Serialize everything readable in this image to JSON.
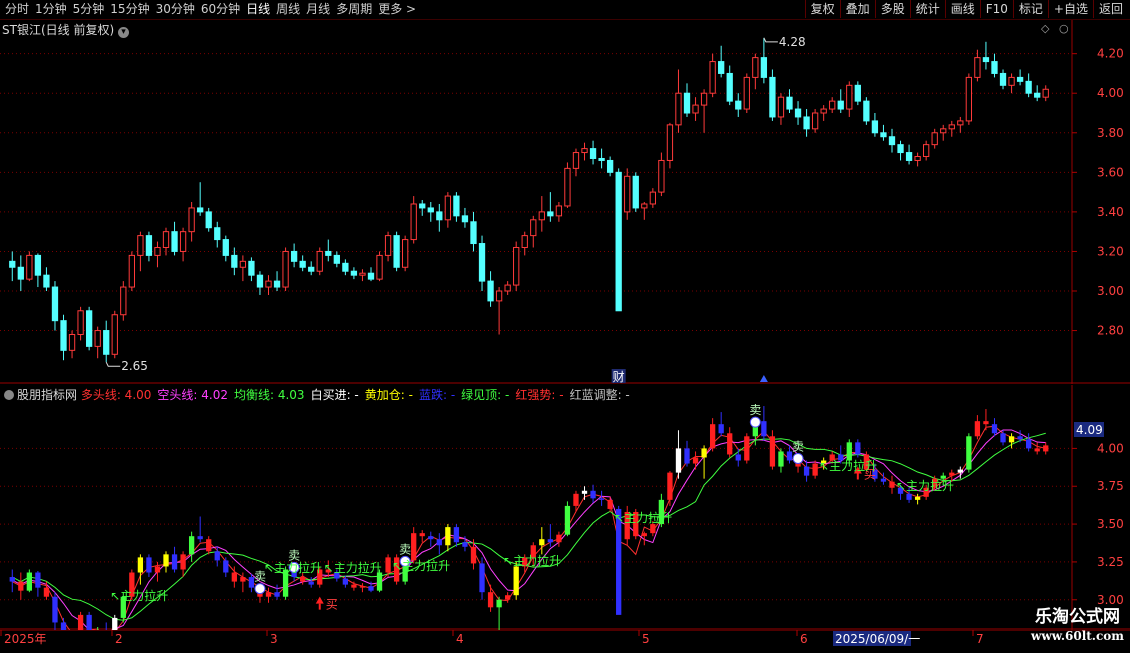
{
  "toolbar": {
    "periods": [
      "分时",
      "1分钟",
      "5分钟",
      "15分钟",
      "30分钟",
      "60分钟",
      "日线",
      "周线",
      "月线",
      "多周期",
      "更多 >"
    ],
    "active_period": "日线",
    "buttons": [
      "复权",
      "叠加",
      "多股",
      "统计",
      "画线",
      "F10",
      "标记",
      "+自选",
      "返回"
    ]
  },
  "main_chart": {
    "title": "ST银江(日线 前复权)",
    "price_axis": [
      "4.20",
      "4.00",
      "3.80",
      "3.60",
      "3.40",
      "3.20",
      "3.00",
      "2.80"
    ],
    "high_label": "4.28",
    "low_label": "2.65",
    "marker_cai": "财"
  },
  "indicator": {
    "name": "股朋指标网",
    "items": [
      {
        "label": "多头线: 4.00",
        "color": "#ff3030"
      },
      {
        "label": "空头线: 4.02",
        "color": "#ff40ff"
      },
      {
        "label": "均衡线: 4.03",
        "color": "#40ff40"
      },
      {
        "label": "白买进: -",
        "color": "#ffffff"
      },
      {
        "label": "黄加仓: -",
        "color": "#ffff00"
      },
      {
        "label": "蓝跌: -",
        "color": "#3030ff"
      },
      {
        "label": "绿见顶: -",
        "color": "#40ff40"
      },
      {
        "label": "红强势: -",
        "color": "#ff3030"
      },
      {
        "label": "红蓝调整: -",
        "color": "#c0c0c0"
      }
    ],
    "price_axis": [
      "4.00",
      "3.75",
      "3.50",
      "3.25",
      "3.00"
    ],
    "current_value": "4.09",
    "signals": {
      "buy": "买",
      "sell": "卖",
      "pull": "主力拉升"
    }
  },
  "time_axis": {
    "labels": [
      "2025年",
      "2",
      "3",
      "4",
      "5",
      "6",
      "7"
    ],
    "cursor_date": "2025/06/09/一"
  },
  "watermark": {
    "line1": "乐淘公式网",
    "line2": "www.60lt.com"
  },
  "colors": {
    "up": "#ff3a3a",
    "down": "#54ffff",
    "grid": "#7a0000",
    "axis_text": "#ff4040"
  },
  "chart_data": {
    "type": "candlestick",
    "ylim": [
      2.55,
      4.35
    ],
    "ohlc": [
      [
        3.15,
        3.2,
        3.05,
        3.12
      ],
      [
        3.12,
        3.18,
        3.0,
        3.06
      ],
      [
        3.06,
        3.2,
        3.05,
        3.18
      ],
      [
        3.18,
        3.19,
        3.02,
        3.08
      ],
      [
        3.08,
        3.12,
        3.0,
        3.02
      ],
      [
        3.02,
        3.05,
        2.8,
        2.85
      ],
      [
        2.85,
        2.88,
        2.65,
        2.7
      ],
      [
        2.7,
        2.8,
        2.66,
        2.78
      ],
      [
        2.78,
        2.92,
        2.75,
        2.9
      ],
      [
        2.9,
        2.92,
        2.7,
        2.72
      ],
      [
        2.72,
        2.82,
        2.66,
        2.8
      ],
      [
        2.8,
        2.85,
        2.64,
        2.68
      ],
      [
        2.68,
        2.9,
        2.66,
        2.88
      ],
      [
        2.88,
        3.05,
        2.85,
        3.02
      ],
      [
        3.02,
        3.2,
        3.0,
        3.18
      ],
      [
        3.18,
        3.3,
        3.1,
        3.28
      ],
      [
        3.28,
        3.3,
        3.15,
        3.18
      ],
      [
        3.18,
        3.25,
        3.12,
        3.22
      ],
      [
        3.22,
        3.32,
        3.18,
        3.3
      ],
      [
        3.3,
        3.35,
        3.18,
        3.2
      ],
      [
        3.2,
        3.32,
        3.15,
        3.3
      ],
      [
        3.3,
        3.45,
        3.25,
        3.42
      ],
      [
        3.42,
        3.55,
        3.38,
        3.4
      ],
      [
        3.4,
        3.42,
        3.3,
        3.32
      ],
      [
        3.32,
        3.35,
        3.22,
        3.26
      ],
      [
        3.26,
        3.28,
        3.15,
        3.18
      ],
      [
        3.18,
        3.22,
        3.08,
        3.12
      ],
      [
        3.12,
        3.18,
        3.05,
        3.15
      ],
      [
        3.15,
        3.17,
        3.05,
        3.08
      ],
      [
        3.08,
        3.1,
        2.98,
        3.02
      ],
      [
        3.02,
        3.08,
        2.98,
        3.05
      ],
      [
        3.05,
        3.1,
        3.0,
        3.02
      ],
      [
        3.02,
        3.22,
        3.0,
        3.2
      ],
      [
        3.2,
        3.24,
        3.12,
        3.15
      ],
      [
        3.15,
        3.18,
        3.1,
        3.12
      ],
      [
        3.12,
        3.15,
        3.08,
        3.1
      ],
      [
        3.1,
        3.22,
        3.08,
        3.2
      ],
      [
        3.2,
        3.26,
        3.15,
        3.18
      ],
      [
        3.18,
        3.2,
        3.12,
        3.14
      ],
      [
        3.14,
        3.16,
        3.08,
        3.1
      ],
      [
        3.1,
        3.12,
        3.06,
        3.08
      ],
      [
        3.08,
        3.11,
        3.05,
        3.09
      ],
      [
        3.09,
        3.12,
        3.05,
        3.06
      ],
      [
        3.06,
        3.2,
        3.05,
        3.18
      ],
      [
        3.18,
        3.3,
        3.15,
        3.28
      ],
      [
        3.28,
        3.3,
        3.1,
        3.12
      ],
      [
        3.12,
        3.28,
        3.1,
        3.26
      ],
      [
        3.26,
        3.48,
        3.24,
        3.44
      ],
      [
        3.44,
        3.46,
        3.38,
        3.42
      ],
      [
        3.42,
        3.45,
        3.35,
        3.4
      ],
      [
        3.4,
        3.44,
        3.3,
        3.36
      ],
      [
        3.36,
        3.5,
        3.32,
        3.48
      ],
      [
        3.48,
        3.5,
        3.35,
        3.38
      ],
      [
        3.38,
        3.42,
        3.32,
        3.35
      ],
      [
        3.35,
        3.4,
        3.2,
        3.24
      ],
      [
        3.24,
        3.28,
        3.0,
        3.05
      ],
      [
        3.05,
        3.1,
        2.92,
        2.95
      ],
      [
        2.95,
        3.02,
        2.78,
        3.0
      ],
      [
        3.0,
        3.05,
        2.98,
        3.03
      ],
      [
        3.03,
        3.25,
        3.0,
        3.22
      ],
      [
        3.22,
        3.3,
        3.18,
        3.28
      ],
      [
        3.28,
        3.38,
        3.22,
        3.36
      ],
      [
        3.36,
        3.48,
        3.3,
        3.4
      ],
      [
        3.4,
        3.5,
        3.35,
        3.38
      ],
      [
        3.38,
        3.45,
        3.35,
        3.43
      ],
      [
        3.43,
        3.65,
        3.42,
        3.62
      ],
      [
        3.62,
        3.72,
        3.58,
        3.7
      ],
      [
        3.7,
        3.75,
        3.66,
        3.72
      ],
      [
        3.72,
        3.76,
        3.64,
        3.67
      ],
      [
        3.67,
        3.72,
        3.62,
        3.66
      ],
      [
        3.66,
        3.68,
        3.58,
        3.6
      ],
      [
        3.6,
        3.62,
        3.28,
        2.9
      ],
      [
        3.4,
        3.62,
        3.36,
        3.58
      ],
      [
        3.58,
        3.6,
        3.4,
        3.42
      ],
      [
        3.42,
        3.45,
        3.36,
        3.44
      ],
      [
        3.44,
        3.52,
        3.42,
        3.5
      ],
      [
        3.5,
        3.7,
        3.48,
        3.66
      ],
      [
        3.66,
        3.85,
        3.62,
        3.84
      ],
      [
        3.84,
        4.12,
        3.8,
        4.0
      ],
      [
        4.0,
        4.05,
        3.88,
        3.9
      ],
      [
        3.9,
        3.98,
        3.86,
        3.94
      ],
      [
        3.94,
        4.02,
        3.8,
        4.0
      ],
      [
        4.0,
        4.2,
        3.98,
        4.16
      ],
      [
        4.16,
        4.24,
        4.08,
        4.1
      ],
      [
        4.1,
        4.14,
        3.94,
        3.96
      ],
      [
        3.96,
        4.0,
        3.88,
        3.92
      ],
      [
        3.92,
        4.1,
        3.9,
        4.08
      ],
      [
        4.08,
        4.2,
        4.02,
        4.18
      ],
      [
        4.18,
        4.28,
        4.05,
        4.08
      ],
      [
        4.08,
        4.12,
        3.86,
        3.88
      ],
      [
        3.88,
        4.0,
        3.84,
        3.98
      ],
      [
        3.98,
        4.02,
        3.9,
        3.92
      ],
      [
        3.92,
        3.96,
        3.84,
        3.88
      ],
      [
        3.88,
        3.92,
        3.78,
        3.82
      ],
      [
        3.82,
        3.92,
        3.8,
        3.9
      ],
      [
        3.9,
        3.94,
        3.86,
        3.92
      ],
      [
        3.92,
        3.98,
        3.9,
        3.96
      ],
      [
        3.96,
        4.02,
        3.9,
        3.92
      ],
      [
        3.92,
        4.06,
        3.88,
        4.04
      ],
      [
        4.04,
        4.06,
        3.94,
        3.96
      ],
      [
        3.96,
        3.98,
        3.84,
        3.86
      ],
      [
        3.86,
        3.9,
        3.78,
        3.8
      ],
      [
        3.8,
        3.84,
        3.76,
        3.78
      ],
      [
        3.78,
        3.82,
        3.7,
        3.74
      ],
      [
        3.74,
        3.76,
        3.66,
        3.7
      ],
      [
        3.7,
        3.74,
        3.64,
        3.66
      ],
      [
        3.66,
        3.7,
        3.63,
        3.68
      ],
      [
        3.68,
        3.76,
        3.66,
        3.74
      ],
      [
        3.74,
        3.82,
        3.72,
        3.8
      ],
      [
        3.8,
        3.84,
        3.76,
        3.82
      ],
      [
        3.82,
        3.86,
        3.78,
        3.84
      ],
      [
        3.84,
        3.88,
        3.8,
        3.86
      ],
      [
        3.86,
        4.1,
        3.84,
        4.08
      ],
      [
        4.08,
        4.22,
        4.06,
        4.18
      ],
      [
        4.18,
        4.26,
        4.12,
        4.16
      ],
      [
        4.16,
        4.2,
        4.08,
        4.1
      ],
      [
        4.1,
        4.12,
        4.02,
        4.04
      ],
      [
        4.04,
        4.1,
        4.0,
        4.08
      ],
      [
        4.08,
        4.12,
        4.04,
        4.06
      ],
      [
        4.06,
        4.1,
        3.98,
        4.0
      ],
      [
        4.0,
        4.04,
        3.96,
        3.98
      ],
      [
        3.98,
        4.04,
        3.96,
        4.02
      ]
    ]
  }
}
